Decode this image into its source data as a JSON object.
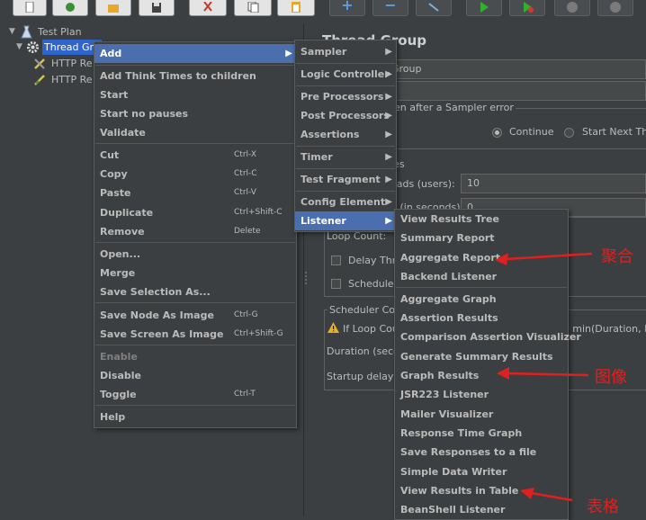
{
  "toolbar": {
    "buttons": [
      {
        "icon": "new-plan-icon"
      },
      {
        "icon": "templates-icon"
      },
      {
        "icon": "open-icon"
      },
      {
        "icon": "save-icon"
      },
      {
        "icon": "cut-icon"
      },
      {
        "icon": "copy-icon"
      },
      {
        "icon": "paste-icon"
      },
      {
        "icon": "expand-icon"
      },
      {
        "icon": "collapse-icon"
      },
      {
        "icon": "toggle-icon"
      },
      {
        "icon": "start-icon"
      },
      {
        "icon": "start-no-pauses-icon"
      },
      {
        "icon": "stop-icon"
      },
      {
        "icon": "shutdown-icon"
      }
    ]
  },
  "tree": {
    "items": [
      {
        "label": "Test Plan",
        "icon": "test-plan-icon"
      },
      {
        "label": "Thread Gro",
        "icon": "thread-group-gear-icon",
        "selected": true
      },
      {
        "label": "HTTP Re",
        "icon": "http-sampler-icon"
      },
      {
        "label": "HTTP Re",
        "icon": "http-sampler-icon"
      }
    ]
  },
  "panel": {
    "title": "Thread Group",
    "name_value": "Group",
    "sampler_error_label": "ken after a Sampler error",
    "continue_label": "Continue",
    "start_next_label": "Start Next Thr",
    "properties_label": "ies",
    "threads_label": "eads (users):",
    "threads_value": "10",
    "ramp_label": "d (in seconds):",
    "ramp_value": "0",
    "loop_count_label": "Loop Count:",
    "delay_label": "Delay Thre",
    "scheduler_label": "Scheduler",
    "scheduler_config_label": "Scheduler Co",
    "if_loop_label": "If Loop Cou",
    "min_duration_label": "e min(Duration, L",
    "duration_label": "Duration (seco",
    "startup_label": "Startup delay ("
  },
  "context_menu": {
    "items": [
      {
        "label": "Add",
        "submenu": true,
        "highlighted": true
      },
      {
        "label": "Add Think Times to children"
      },
      {
        "label": "Start"
      },
      {
        "label": "Start no pauses"
      },
      {
        "label": "Validate"
      },
      {
        "label": "Cut",
        "shortcut": "Ctrl-X"
      },
      {
        "label": "Copy",
        "shortcut": "Ctrl-C"
      },
      {
        "label": "Paste",
        "shortcut": "Ctrl-V"
      },
      {
        "label": "Duplicate",
        "shortcut": "Ctrl+Shift-C"
      },
      {
        "label": "Remove",
        "shortcut": "Delete"
      },
      {
        "label": "Open..."
      },
      {
        "label": "Merge"
      },
      {
        "label": "Save Selection As..."
      },
      {
        "label": "Save Node As Image",
        "shortcut": "Ctrl-G"
      },
      {
        "label": "Save Screen As Image",
        "shortcut": "Ctrl+Shift-G"
      },
      {
        "label": "Enable",
        "disabled": true
      },
      {
        "label": "Disable"
      },
      {
        "label": "Toggle",
        "shortcut": "Ctrl-T"
      },
      {
        "label": "Help"
      }
    ]
  },
  "add_submenu": {
    "items": [
      {
        "label": "Sampler"
      },
      {
        "label": "Logic Controller"
      },
      {
        "label": "Pre Processors"
      },
      {
        "label": "Post Processors"
      },
      {
        "label": "Assertions"
      },
      {
        "label": "Timer"
      },
      {
        "label": "Test Fragment"
      },
      {
        "label": "Config Element"
      },
      {
        "label": "Listener",
        "highlighted": true
      }
    ]
  },
  "listener_submenu": {
    "items": [
      "View Results Tree",
      "Summary Report",
      "Aggregate Report",
      "Backend Listener",
      "Aggregate Graph",
      "Assertion Results",
      "Comparison Assertion Visualizer",
      "Generate Summary Results",
      "Graph Results",
      "JSR223 Listener",
      "Mailer Visualizer",
      "Response Time Graph",
      "Save Responses to a file",
      "Simple Data Writer",
      "View Results in Table",
      "BeanShell Listener"
    ]
  },
  "annotations": {
    "aggregate": "聚合",
    "graph": "图像",
    "table": "表格",
    "color": "#e0201e"
  }
}
